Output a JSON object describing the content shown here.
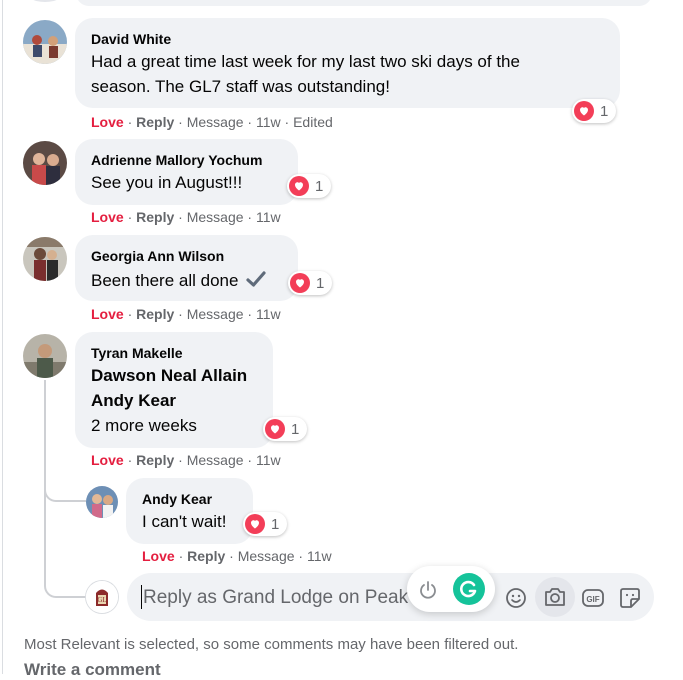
{
  "comments": [
    {
      "author": "David White",
      "lines": [
        "Had a great time last week for my last two ski days of the",
        "season. The GL7 staff was outstanding!"
      ],
      "reaction_count": "1",
      "love": "Love",
      "reply": "Reply",
      "message": "Message",
      "time": "11w",
      "edited": "Edited"
    },
    {
      "author": "Adrienne Mallory Yochum",
      "lines": [
        "See you in August!!!"
      ],
      "reaction_count": "1",
      "love": "Love",
      "reply": "Reply",
      "message": "Message",
      "time": "11w"
    },
    {
      "author": "Georgia Ann Wilson",
      "lines": [
        "Been there all done"
      ],
      "emoji": "✔️",
      "reaction_count": "1",
      "love": "Love",
      "reply": "Reply",
      "message": "Message",
      "time": "11w"
    },
    {
      "author": "Tyran Makelle",
      "mentions": [
        "Dawson Neal Allain",
        "Andy Kear"
      ],
      "lines": [
        "2 more weeks"
      ],
      "reaction_count": "1",
      "love": "Love",
      "reply": "Reply",
      "message": "Message",
      "time": "11w"
    },
    {
      "author": "Andy Kear",
      "lines": [
        "I can't wait!"
      ],
      "reaction_count": "1",
      "love": "Love",
      "reply": "Reply",
      "message": "Message",
      "time": "11w"
    }
  ],
  "reply_box": {
    "placeholder": "Reply as Grand Lodge on Peak"
  },
  "footer": {
    "filter_note": "Most Relevant is selected, so some comments may have been filtered out.",
    "write_comment": "Write a comment"
  },
  "icons": {
    "reaction": "heart-icon",
    "emoji": "smiley-icon",
    "camera": "camera-icon",
    "gif": "gif-icon",
    "sticker": "sticker-icon",
    "grammarly": "grammarly-icon",
    "power": "power-icon"
  },
  "colors": {
    "love": "#e41e3f",
    "heart": "#f33e58",
    "bubble": "#f0f2f5",
    "meta": "#65676b",
    "grammarly": "#15c39a"
  }
}
